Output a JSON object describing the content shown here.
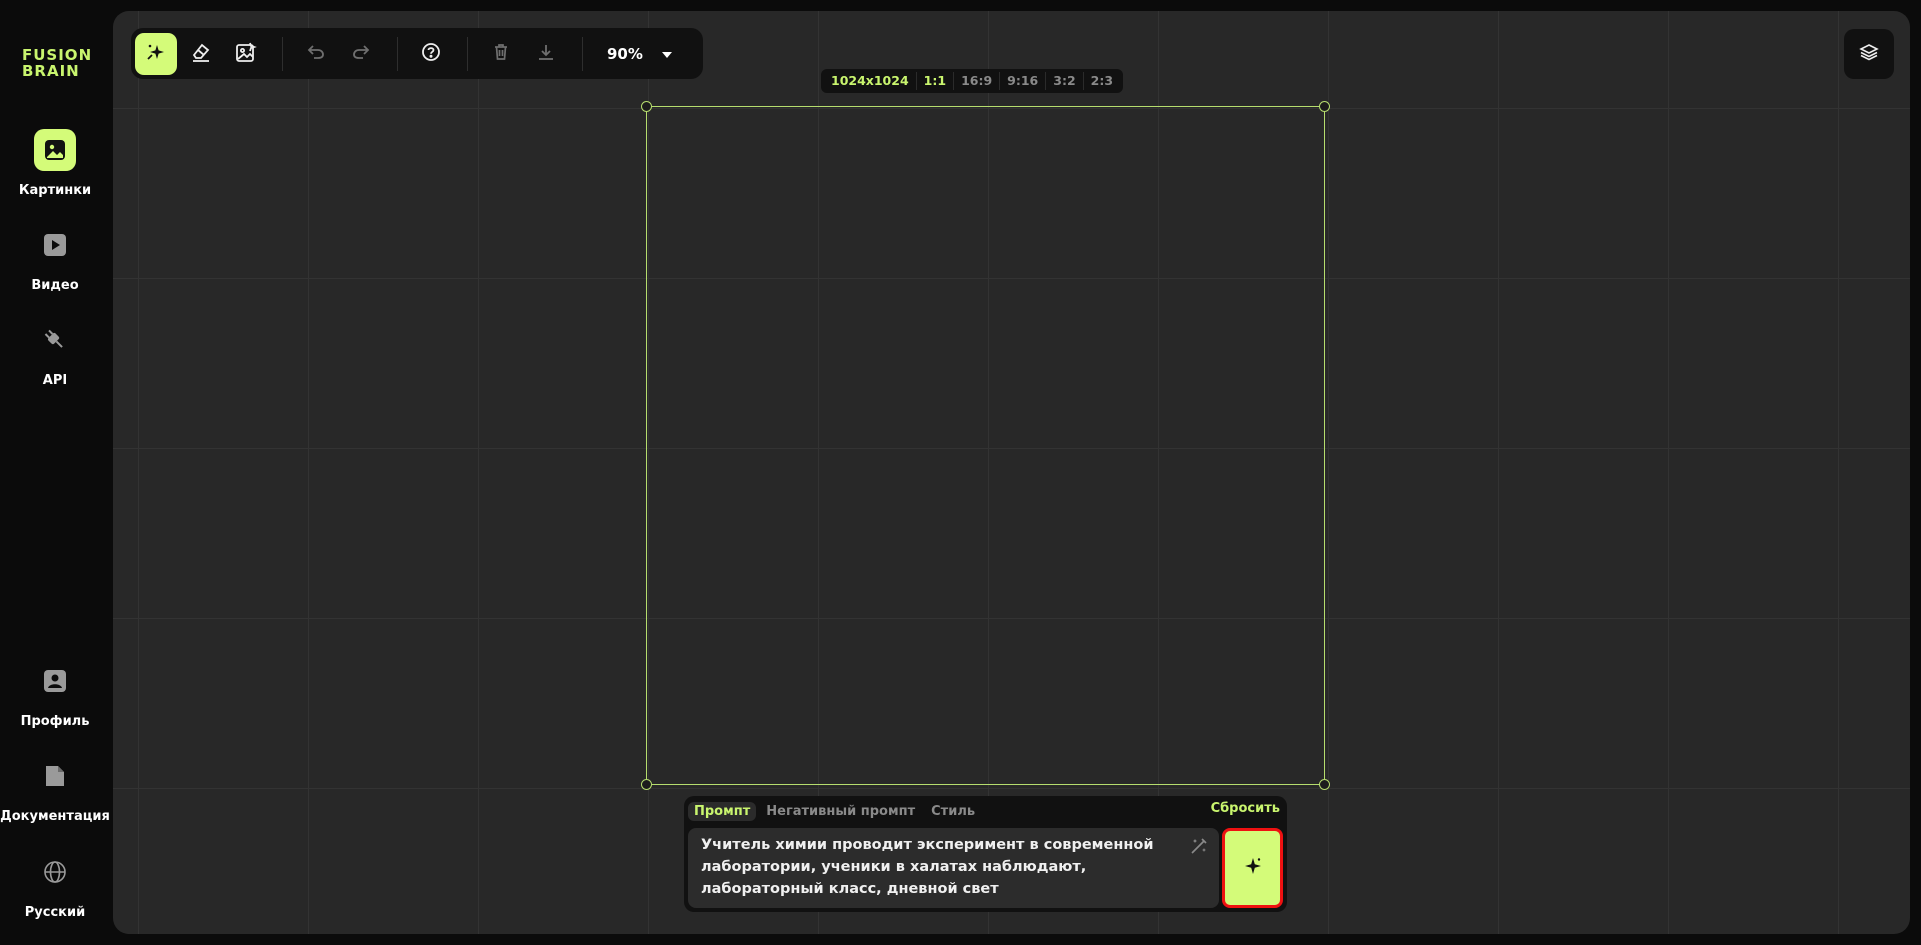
{
  "app": {
    "logo_line1": "FUSION",
    "logo_line2": "BRAIN",
    "accent": "#d4fb79"
  },
  "sidebar": {
    "items": [
      {
        "label": "Картинки",
        "icon": "image-icon",
        "active": true
      },
      {
        "label": "Видео",
        "icon": "video-play-icon",
        "active": false
      },
      {
        "label": "API",
        "icon": "plug-icon",
        "active": false
      },
      {
        "label": "Профиль",
        "icon": "profile-icon",
        "active": false
      },
      {
        "label": "Документация",
        "icon": "document-icon",
        "active": false
      },
      {
        "label": "Русский",
        "icon": "globe-icon",
        "active": false
      }
    ]
  },
  "toolbar": {
    "tools": [
      "generate-sparkle-icon",
      "eraser-icon",
      "image-edit-icon",
      "undo-icon",
      "redo-icon",
      "help-icon",
      "trash-icon",
      "download-icon"
    ],
    "zoom": "90%"
  },
  "ratios": {
    "size": "1024x1024",
    "options": [
      "1:1",
      "16:9",
      "9:16",
      "3:2",
      "2:3"
    ],
    "selected": "1:1"
  },
  "prompt": {
    "tabs": [
      "Промпт",
      "Негативный промпт",
      "Стиль"
    ],
    "active_tab": "Промпт",
    "reset_label": "Сбросить",
    "text": "Учитель химии проводит эксперимент в современной лаборатории, ученики в халатах наблюдают, лабораторный класс, дневной свет"
  }
}
